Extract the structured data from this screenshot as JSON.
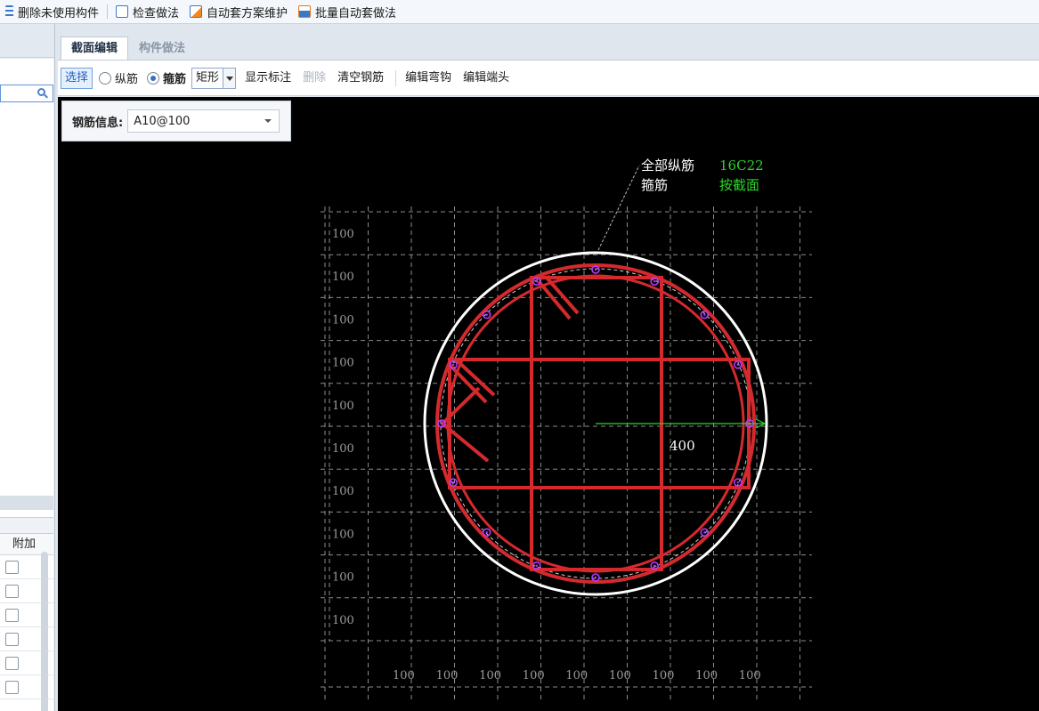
{
  "toolbar": {
    "items": [
      {
        "label": "删除未使用构件",
        "icon": "list-delete-icon"
      },
      {
        "label": "检查做法",
        "icon": "check-document-icon"
      },
      {
        "label": "自动套方案维护",
        "icon": "gear-document-icon"
      },
      {
        "label": "批量自动套做法",
        "icon": "batch-apply-icon"
      }
    ]
  },
  "left_panel": {
    "grid_header": "附加"
  },
  "tabs": [
    {
      "label": "截面编辑",
      "active": true
    },
    {
      "label": "构件做法",
      "active": false
    }
  ],
  "edit_toolbar": {
    "select": "选择",
    "radio_longitudinal": "纵筋",
    "radio_stirrup": "箍筋",
    "shape_value": "矩形",
    "show_annotation": "显示标注",
    "delete": "删除",
    "clear_rebar": "清空钢筋",
    "edit_hook": "编辑弯钩",
    "edit_end": "编辑端头"
  },
  "info": {
    "label": "钢筋信息:",
    "value": "A10@100"
  },
  "drawing": {
    "annotation_all_long": "全部纵筋",
    "annotation_all_long_value": "16C22",
    "annotation_stirrup": "箍筋",
    "annotation_stirrup_value": "按截面",
    "radius_label": "400",
    "grid_row_labels": [
      "100",
      "100",
      "100",
      "100",
      "100",
      "100",
      "100",
      "100",
      "100",
      "100"
    ],
    "grid_col_labels": [
      "100",
      "100",
      "100",
      "100",
      "100",
      "100",
      "100",
      "100",
      "100"
    ],
    "colors": {
      "rebar_red": "#d42a2e",
      "outline_white": "#ffffff",
      "annotation_green": "#29d629",
      "bar_magenta": "#b43cff",
      "grid_gray": "#8c8c8c"
    }
  }
}
